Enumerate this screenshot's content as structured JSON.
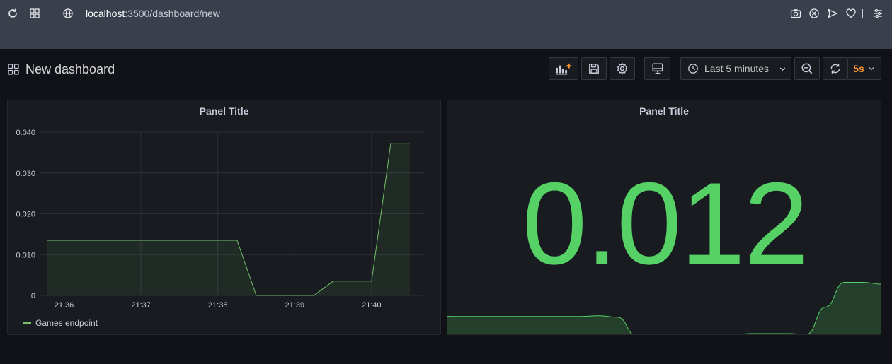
{
  "browser": {
    "url_host": "localhost",
    "url_path": ":3500/dashboard/new"
  },
  "dashboard": {
    "title": "New dashboard",
    "time_range": "Last 5 minutes",
    "refresh_interval": "5s"
  },
  "panels": [
    {
      "title": "Panel Title",
      "legend": "Games endpoint"
    },
    {
      "title": "Panel Title",
      "value": "0.012"
    }
  ],
  "colors": {
    "series": "#73bf69",
    "stat": "#56d166",
    "refresh": "#ff9830"
  },
  "chart_data": [
    {
      "type": "area",
      "title": "Panel Title",
      "xlabel": "",
      "ylabel": "",
      "x_ticks": [
        "21:36",
        "21:37",
        "21:38",
        "21:39",
        "21:40"
      ],
      "y_ticks": [
        "0",
        "0.010",
        "0.020",
        "0.030",
        "0.040"
      ],
      "ylim": [
        0,
        0.04
      ],
      "grid": true,
      "legend_position": "bottom-left",
      "series": [
        {
          "name": "Games endpoint",
          "x": [
            "21:35:47",
            "21:38:15",
            "21:38:30",
            "21:39:15",
            "21:39:30",
            "21:40:00",
            "21:40:15",
            "21:40:30"
          ],
          "y": [
            0.0135,
            0.0135,
            0.0,
            0.0,
            0.0035,
            0.0035,
            0.0373,
            0.0373
          ]
        }
      ]
    },
    {
      "type": "area",
      "title": "Panel Title",
      "values": [
        0.0135,
        0.0135,
        0.0135,
        0.0135,
        0.0135,
        0.0135,
        0.0135,
        0.0135,
        0.014,
        0.013,
        0.0,
        0.0,
        0.0,
        0.0,
        0.0,
        0.0,
        0.0015,
        0.0015,
        0.0015,
        0.001,
        0.02,
        0.0373,
        0.0373,
        0.036
      ]
    }
  ]
}
